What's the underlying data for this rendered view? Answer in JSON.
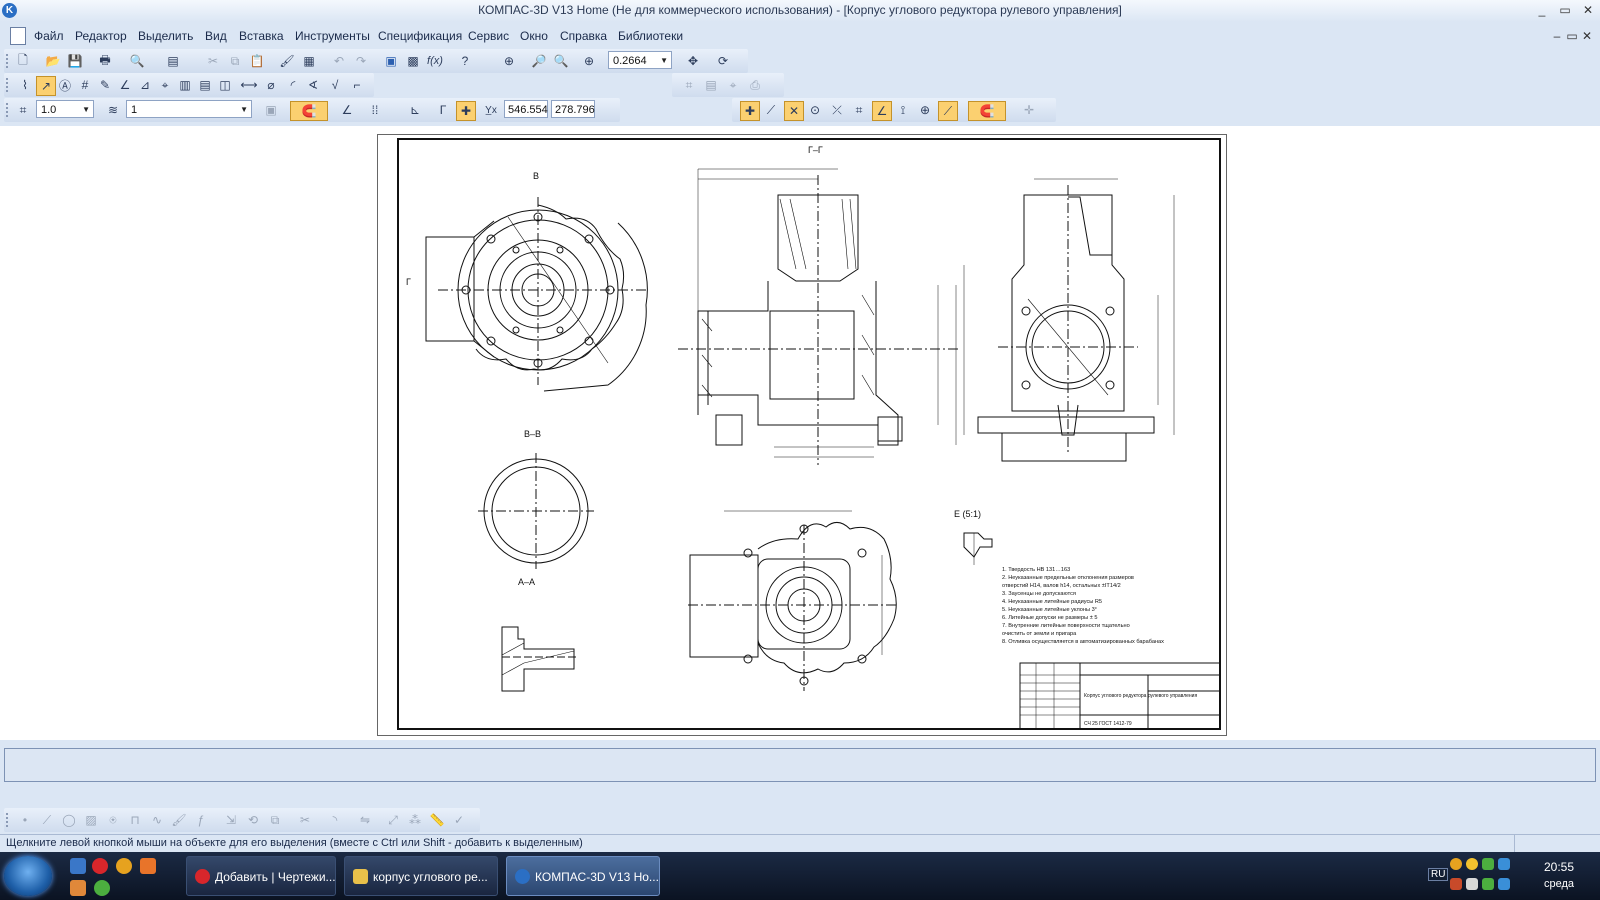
{
  "window": {
    "title": "КОМПАС-3D V13 Home (Не для коммерческого использования) - [Корпус углового редуктора рулевого управления]",
    "minimize": "_",
    "maximize": "▭",
    "close": "✕",
    "doc_minimize": "–",
    "doc_maximize": "▭",
    "doc_close": "✕"
  },
  "menu": {
    "items": [
      "Файл",
      "Редактор",
      "Выделить",
      "Вид",
      "Вставка",
      "Инструменты",
      "Спецификация",
      "Сервис",
      "Окно",
      "Справка",
      "Библиотеки"
    ]
  },
  "toolbar": {
    "zoom_value": "0.2664",
    "step_value": "1.0",
    "layer_value": "1",
    "coord_x": "546.554",
    "coord_y": "278.796"
  },
  "drawing": {
    "section_gg": "Г–Г",
    "label_v_top": "В",
    "label_g_left": "Г",
    "section_vv": "В–В",
    "section_aa": "А–А",
    "detail_e": "Е (5:1)",
    "notes": [
      "1. Твердость НВ 131…163",
      "2. Неуказанные предельные отклонения размеров",
      "отверстий Н14, валов h14, остальных ±IT14/2",
      "3. Заусенцы не допускаются",
      "4. Неуказанные литейные радиусы R5",
      "5. Неуказанные литейные уклоны 3°",
      "6. Литейные допуски не размеры ± 5",
      "7. Внутренние литейные поверхности тщательно",
      "очистить от земли и пригара",
      "8. Отливка осуществляется в автоматизированных барабанах"
    ],
    "stamp_name": "Корпус углового редуктора рулевого управления",
    "stamp_material": "СЧ 25 ГОСТ 1412-79"
  },
  "status": {
    "hint": "Щелкните левой кнопкой мыши на объекте для его выделения (вместе с Ctrl или Shift - добавить к выделенным)"
  },
  "taskbar": {
    "tasks": [
      "Добавить | Чертежи...",
      "корпус углового ре...",
      "КОМПАС-3D V13 Ho..."
    ],
    "lang": "RU",
    "time": "20:55",
    "day": "среда"
  },
  "colors": {
    "accent": "#fbd070",
    "window_bg": "#dbe6f4",
    "taskbar": "#0b1322"
  }
}
